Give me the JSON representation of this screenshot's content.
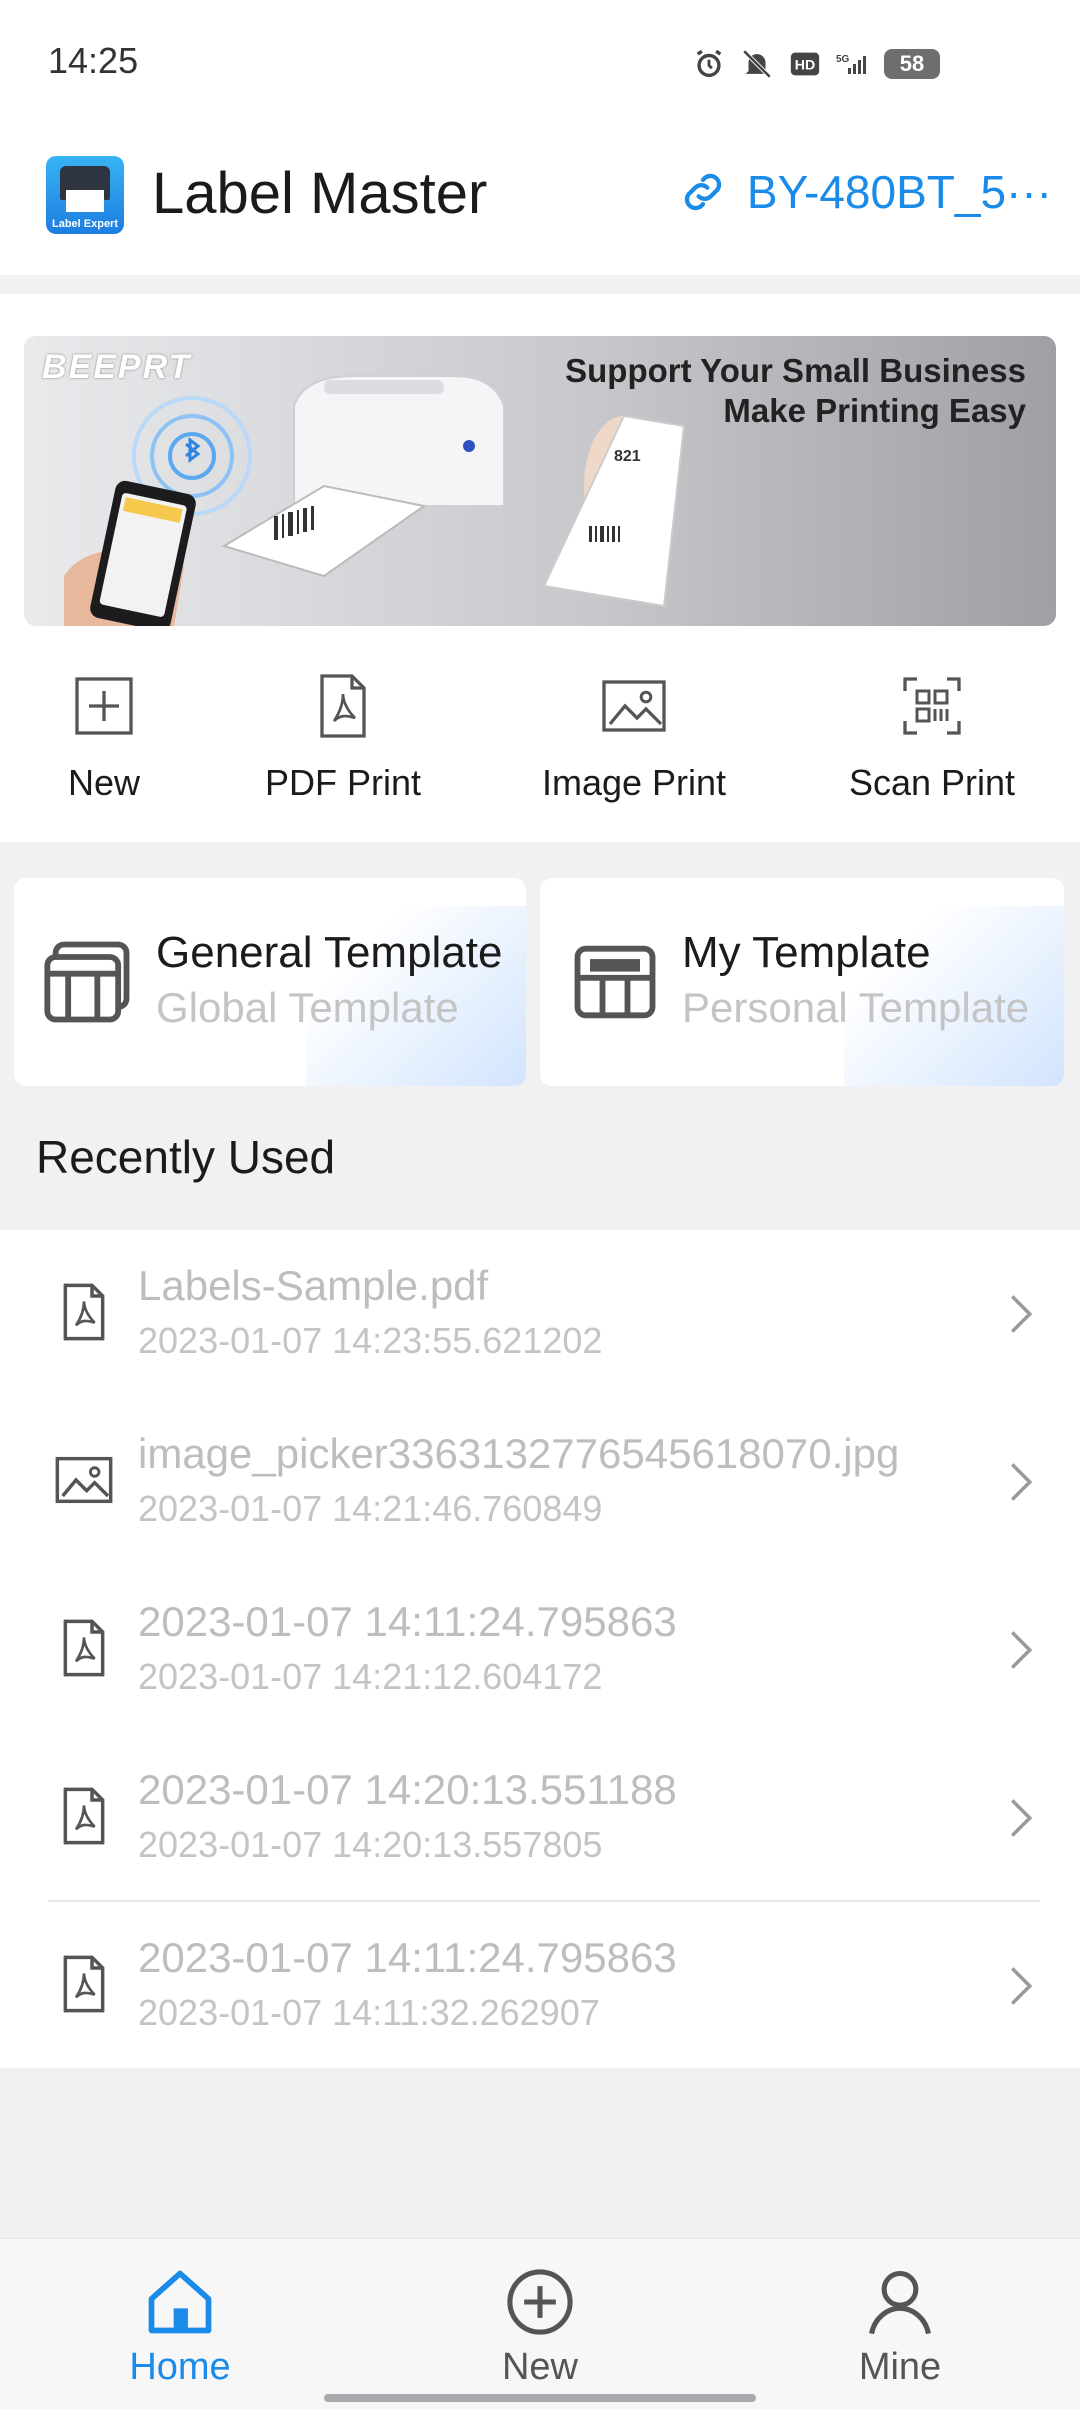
{
  "status_bar": {
    "time": "14:25",
    "network": "5G",
    "battery": "58"
  },
  "header": {
    "app_title": "Label Master",
    "device_name": "BY-480BT_5···",
    "logo_text": "Label Expert"
  },
  "banner": {
    "brand": "BEEPRT",
    "line1": "Support Your Small Business",
    "line2": "Make Printing Easy"
  },
  "quick_actions": [
    {
      "label": "New",
      "icon": "plus-square-icon"
    },
    {
      "label": "PDF Print",
      "icon": "pdf-file-icon"
    },
    {
      "label": "Image Print",
      "icon": "image-icon"
    },
    {
      "label": "Scan Print",
      "icon": "scan-icon"
    }
  ],
  "templates": [
    {
      "title": "General Template",
      "subtitle": "Global Template"
    },
    {
      "title": "My Template",
      "subtitle": "Personal Template"
    }
  ],
  "recent": {
    "title": "Recently Used",
    "items": [
      {
        "name": "Labels-Sample.pdf",
        "time": "2023-01-07 14:23:55.621202",
        "type": "pdf"
      },
      {
        "name": "image_picker3363132776545618070.jpg",
        "time": "2023-01-07 14:21:46.760849",
        "type": "image"
      },
      {
        "name": "2023-01-07 14:11:24.795863",
        "time": "2023-01-07 14:21:12.604172",
        "type": "pdf"
      },
      {
        "name": "2023-01-07 14:20:13.551188",
        "time": "2023-01-07 14:20:13.557805",
        "type": "pdf"
      },
      {
        "name": "2023-01-07 14:11:24.795863",
        "time": "2023-01-07 14:11:32.262907",
        "type": "pdf"
      }
    ]
  },
  "bottom_nav": [
    {
      "label": "Home",
      "active": true
    },
    {
      "label": "New",
      "active": false
    },
    {
      "label": "Mine",
      "active": false
    }
  ],
  "colors": {
    "accent": "#1a8be8",
    "active_nav": "#1a8be8",
    "muted_text": "#c4c4c4"
  }
}
